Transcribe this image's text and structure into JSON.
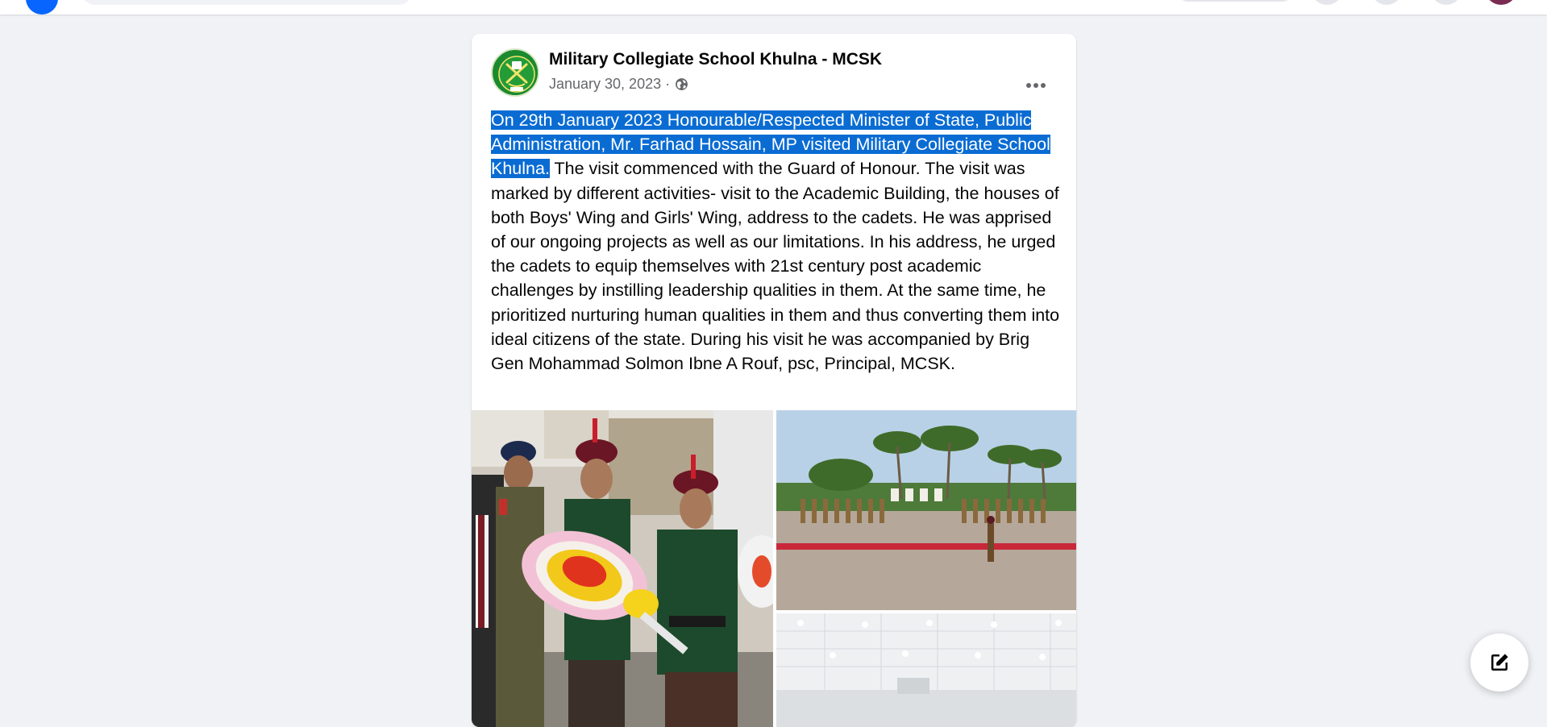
{
  "colors": {
    "page_bg": "#f0f2f5",
    "card_bg": "#ffffff",
    "selection": "#0a6cd3",
    "brand": "#0866ff",
    "meta_text": "#65676b"
  },
  "topbar": {
    "logo_icon": "facebook-logo-icon",
    "avatar_icon": "profile-avatar-icon"
  },
  "post": {
    "author": "Military Collegiate School Khulna - MCSK",
    "date": "January 30, 2023",
    "separator": "·",
    "audience_icon": "globe-icon",
    "more_icon": "more-horizontal-icon",
    "text_highlighted": "On 29th January 2023 Honourable/Respected Minister of State, Public Administration, Mr. Farhad Hossain, MP visited Military Collegiate School Khulna.",
    "text_rest": " The visit commenced with the Guard of Honour. The visit was marked by different activities- visit to the Academic Building, the houses of both Boys' Wing and Girls' Wing, address to the cadets. He was apprised of our ongoing projects as well as our limitations. In his address, he urged the cadets to equip themselves with 21st century post academic challenges by instilling leadership qualities in them. At the same time, he prioritized nurturing human qualities in them and thus converting them into ideal citizens of the state. During his visit he was accompanied by Brig Gen Mohammad Solmon Ibne A Rouf, psc, Principal, MCSK."
  },
  "compose": {
    "icon": "compose-icon"
  }
}
